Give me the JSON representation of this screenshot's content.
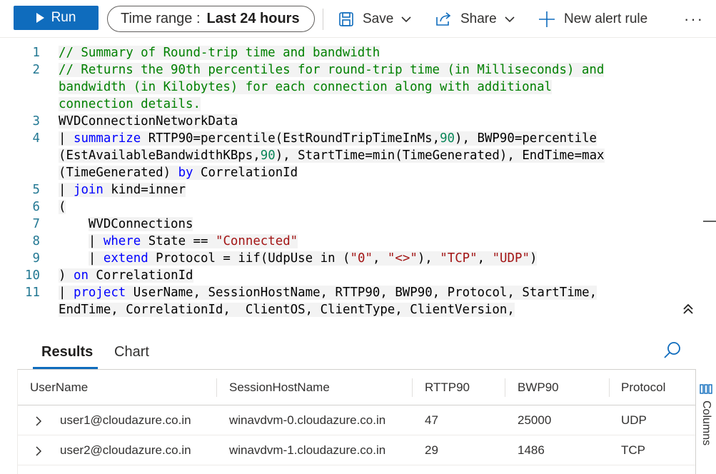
{
  "toolbar": {
    "run_label": "Run",
    "time_range_label": "Time range :",
    "time_range_value": "Last 24 hours",
    "save_label": "Save",
    "share_label": "Share",
    "new_alert_label": "New alert rule",
    "more_label": "···"
  },
  "editor": {
    "line_numbers": [
      "1",
      "2",
      "3",
      "4",
      "5",
      "6",
      "7",
      "8",
      "9",
      "10",
      "11"
    ],
    "lines": [
      "// Summary of Round-trip time and bandwidth",
      "// Returns the 90th percentiles for round-trip time (in Milliseconds) and",
      "bandwidth (in Kilobytes) for each connection along with additional",
      "connection details.",
      "WVDConnectionNetworkData",
      "| summarize RTTP90=percentile(EstRoundTripTimeInMs,90), BWP90=percentile",
      "(EstAvailableBandwidthKBps,90), StartTime=min(TimeGenerated), EndTime=max",
      "(TimeGenerated) by CorrelationId",
      "| join kind=inner",
      "(",
      "    WVDConnections",
      "    | where State == \"Connected\"",
      "    | extend Protocol = iif(UdpUse in (\"0\", \"<>\"), \"TCP\", \"UDP\")",
      ") on CorrelationId",
      "| project UserName, SessionHostName, RTTP90, BWP90, Protocol, StartTime,",
      "EndTime, CorrelationId,  ClientOS, ClientType, ClientVersion,"
    ]
  },
  "results": {
    "tabs": [
      "Results",
      "Chart"
    ],
    "columns_label": "Columns",
    "headers": [
      "UserName",
      "SessionHostName",
      "RTTP90",
      "BWP90",
      "Protocol"
    ],
    "rows": [
      [
        "user1@cloudazure.co.in",
        "winavdvm-0.cloudazure.co.in",
        "47",
        "25000",
        "UDP"
      ],
      [
        "user2@cloudazure.co.in",
        "winavdvm-1.cloudazure.co.in",
        "29",
        "1486",
        "TCP"
      ]
    ]
  },
  "colors": {
    "accent": "#0f6cbd",
    "comment": "#008000",
    "keyword": "#0000ff",
    "number": "#098658",
    "string": "#a31515",
    "line_number": "#237893"
  }
}
